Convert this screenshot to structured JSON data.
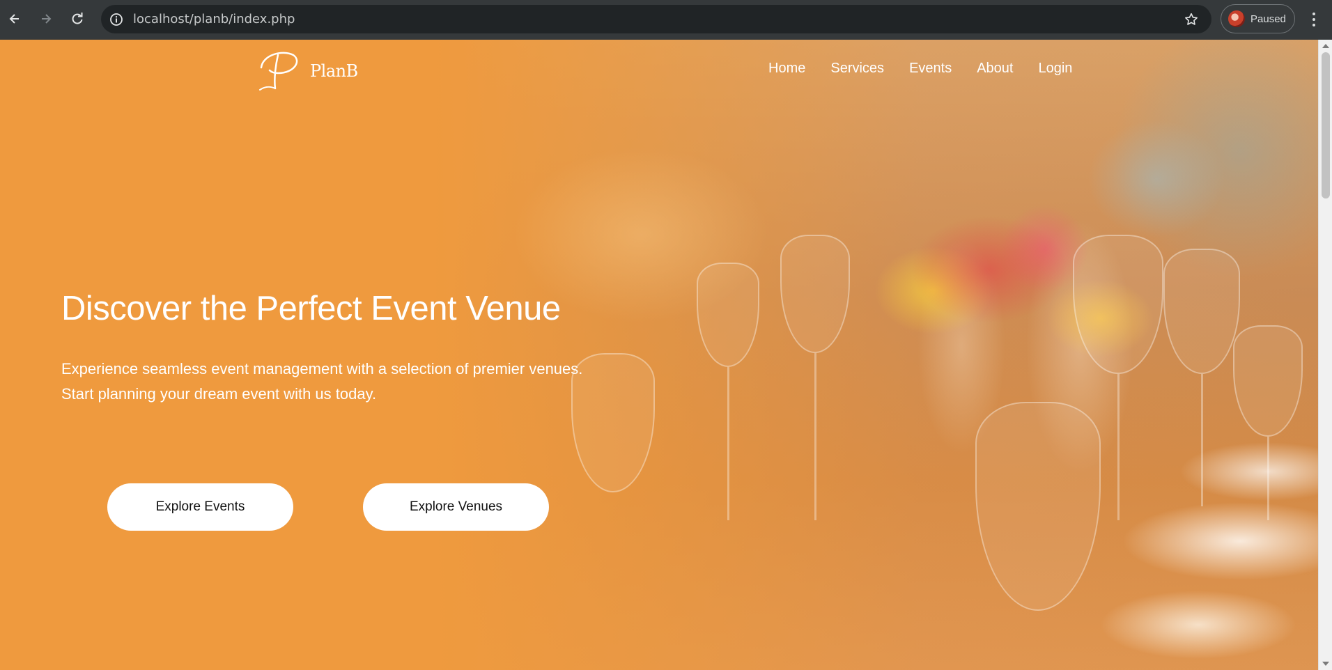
{
  "browser": {
    "url": "localhost/planb/index.php",
    "profile_status": "Paused",
    "icons": {
      "back": "back-arrow-icon",
      "forward": "forward-arrow-icon",
      "reload": "reload-icon",
      "info": "site-info-icon",
      "bookmark": "bookmark-star-icon",
      "menu": "kebab-menu-icon"
    }
  },
  "site": {
    "brand": "PlanB",
    "nav": [
      "Home",
      "Services",
      "Events",
      "About",
      "Login"
    ]
  },
  "hero": {
    "title": "Discover the Perfect Event Venue",
    "subtitle_line1": "Experience seamless event management with a selection of premier venues.",
    "subtitle_line2": "Start planning your dream event with us today.",
    "buttons": {
      "events": "Explore Events",
      "venues": "Explore Venues"
    }
  },
  "colors": {
    "hero_bg": "#ef9a3e",
    "chrome_bg": "#35393b",
    "button_bg": "#ffffff"
  }
}
